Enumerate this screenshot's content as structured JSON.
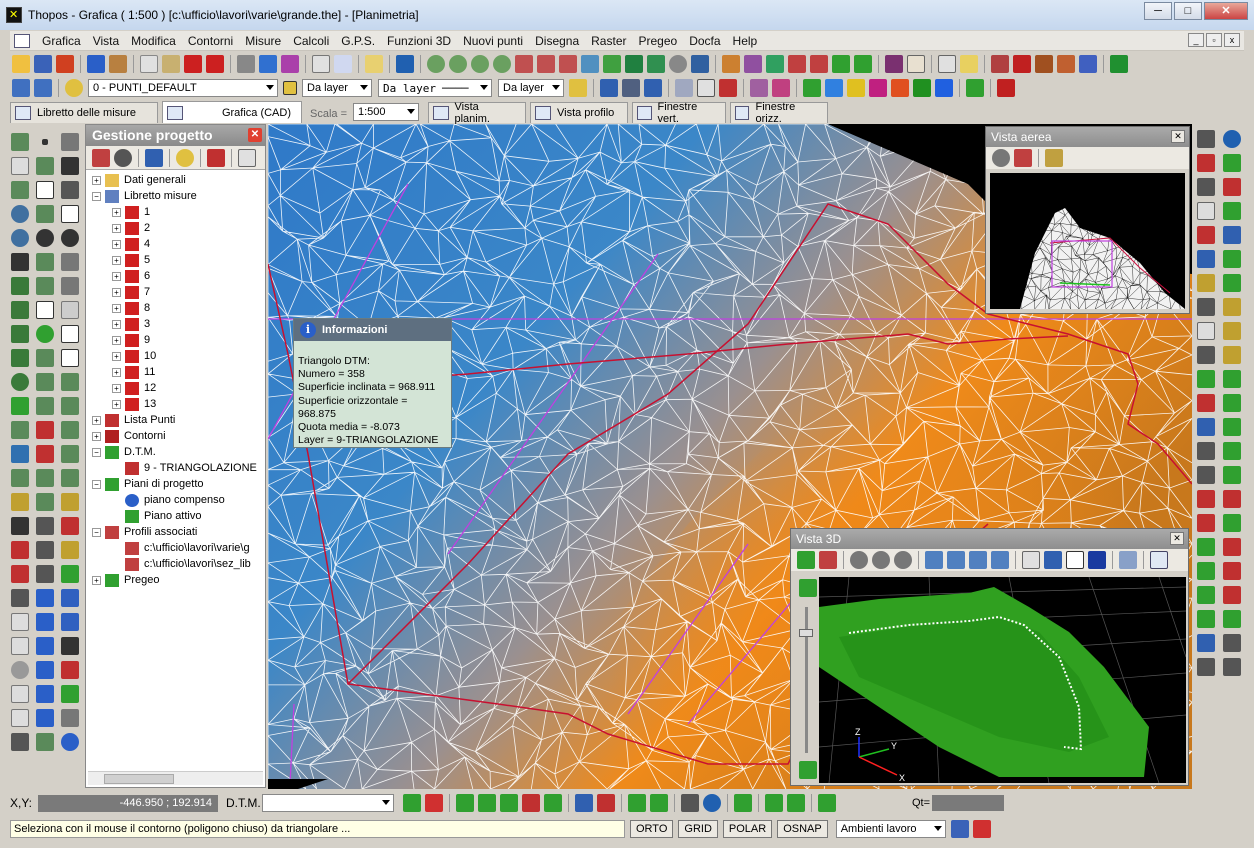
{
  "window": {
    "title": "Thopos - Grafica ( 1:500 ) [c:\\ufficio\\lavori\\varie\\grande.the] - [Planimetria]",
    "min": "─",
    "max": "□",
    "close": "✕"
  },
  "menu": [
    "Grafica",
    "Vista",
    "Modifica",
    "Contorni",
    "Misure",
    "Calcoli",
    "G.P.S.",
    "Funzioni 3D",
    "Nuovi punti",
    "Disegna",
    "Raster",
    "Pregeo",
    "Docfa",
    "Help"
  ],
  "toolbar2": {
    "layer": "0 - PUNTI_DEFAULT",
    "color": "Da layer",
    "linetype": "Da layer",
    "lineweight": "Da layer"
  },
  "tabs": {
    "libretto": "Libretto delle misure",
    "grafica": "Grafica (CAD)",
    "scala_label": "Scala =",
    "scala_value": "1:500",
    "vista_planim": "Vista planim.",
    "vista_profilo": "Vista profilo",
    "finestre_vert": "Finestre vert.",
    "finestre_orizz": "Finestre orizz."
  },
  "project_panel": {
    "title": "Gestione progetto",
    "tree": [
      {
        "label": "Dati generali",
        "level": 0,
        "exp": "+",
        "icon": "folder-icon"
      },
      {
        "label": "Libretto misure",
        "level": 0,
        "exp": "−",
        "icon": "pen-icon"
      },
      {
        "label": "1",
        "level": 1,
        "exp": "+",
        "icon": "station-icon"
      },
      {
        "label": "2",
        "level": 1,
        "exp": "+",
        "icon": "station-icon"
      },
      {
        "label": "4",
        "level": 1,
        "exp": "+",
        "icon": "station-icon"
      },
      {
        "label": "5",
        "level": 1,
        "exp": "+",
        "icon": "station-icon"
      },
      {
        "label": "6",
        "level": 1,
        "exp": "+",
        "icon": "station-icon"
      },
      {
        "label": "7",
        "level": 1,
        "exp": "+",
        "icon": "station-icon"
      },
      {
        "label": "8",
        "level": 1,
        "exp": "+",
        "icon": "station-icon"
      },
      {
        "label": "3",
        "level": 1,
        "exp": "+",
        "icon": "station-icon"
      },
      {
        "label": "9",
        "level": 1,
        "exp": "+",
        "icon": "station-icon"
      },
      {
        "label": "10",
        "level": 1,
        "exp": "+",
        "icon": "station-icon"
      },
      {
        "label": "11",
        "level": 1,
        "exp": "+",
        "icon": "station-icon"
      },
      {
        "label": "12",
        "level": 1,
        "exp": "+",
        "icon": "station-icon"
      },
      {
        "label": "13",
        "level": 1,
        "exp": "+",
        "icon": "station-icon"
      },
      {
        "label": "Lista Punti",
        "level": 0,
        "exp": "+",
        "icon": "list-icon"
      },
      {
        "label": "Contorni",
        "level": 0,
        "exp": "+",
        "icon": "contour-icon"
      },
      {
        "label": "D.T.M.",
        "level": 0,
        "exp": "−",
        "icon": "tree-icon"
      },
      {
        "label": "9 - TRIANGOLAZIONE",
        "level": 1,
        "exp": "",
        "icon": "triangle-icon"
      },
      {
        "label": "Piani di progetto",
        "level": 0,
        "exp": "−",
        "icon": "plane-icon"
      },
      {
        "label": "piano compenso",
        "level": 1,
        "exp": "",
        "icon": "info-icon"
      },
      {
        "label": "Piano attivo",
        "level": 1,
        "exp": "",
        "icon": "plane-icon"
      },
      {
        "label": "Profili associati",
        "level": 0,
        "exp": "−",
        "icon": "profile-icon"
      },
      {
        "label": "c:\\ufficio\\lavori\\varie\\g",
        "level": 1,
        "exp": "",
        "icon": "profile-icon"
      },
      {
        "label": "c:\\ufficio\\lavori\\sez_lib",
        "level": 1,
        "exp": "",
        "icon": "profile-icon"
      },
      {
        "label": "Pregeo",
        "level": 0,
        "exp": "+",
        "icon": "pregeo-icon"
      }
    ]
  },
  "info": {
    "title": "Informazioni",
    "lines": [
      "Triangolo DTM:",
      "Numero = 358",
      "Superficie inclinata = 968.911",
      "Superficie orizzontale = 968.875",
      "Quota media = -8.073",
      "Layer = 9-TRIANGOLAZIONE"
    ]
  },
  "vista_aerea": {
    "title": "Vista aerea"
  },
  "vista_3d": {
    "title": "Vista 3D",
    "axis_x": "X",
    "axis_y": "Y",
    "axis_z": "Z"
  },
  "coords": {
    "label": "X,Y:",
    "value": "-446.950 ; 192.914",
    "dtm_label": "D.T.M.",
    "qt_label": "Qt="
  },
  "status": {
    "message": "Seleziona con il mouse il contorno (poligono chiuso) da triangolare ...",
    "orto": "ORTO",
    "grid": "GRID",
    "polar": "POLAR",
    "osnap": "OSNAP",
    "ambienti": "Ambienti lavoro"
  },
  "colors": {
    "canvas_blue": "#2f79c8",
    "canvas_orange": "#ef8a1a",
    "dtm_lines": "#ffffff",
    "red_contour": "#c81030",
    "magenta_lines": "#c040e0",
    "terrain_green": "#30b020"
  }
}
